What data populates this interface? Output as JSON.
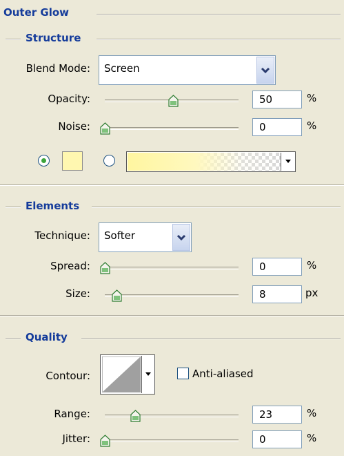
{
  "outer_glow": {
    "title": "Outer Glow",
    "structure": {
      "title": "Structure",
      "blend_mode_label": "Blend Mode:",
      "blend_mode_value": "Screen",
      "opacity_label": "Opacity:",
      "opacity_value": "50",
      "opacity_unit": "%",
      "noise_label": "Noise:",
      "noise_value": "0",
      "noise_unit": "%",
      "color_swatch": "#fff7b0",
      "gradient_colors": [
        "#fff7a6",
        "#fffbe0"
      ]
    },
    "elements": {
      "title": "Elements",
      "technique_label": "Technique:",
      "technique_value": "Softer",
      "spread_label": "Spread:",
      "spread_value": "0",
      "spread_unit": "%",
      "size_label": "Size:",
      "size_value": "8",
      "size_unit": "px"
    },
    "quality": {
      "title": "Quality",
      "contour_label": "Contour:",
      "anti_aliased_label": "Anti-aliased",
      "range_label": "Range:",
      "range_value": "23",
      "range_unit": "%",
      "jitter_label": "Jitter:",
      "jitter_value": "0",
      "jitter_unit": "%"
    }
  },
  "icons": {
    "dropdown_arrow": "chevron-down-icon",
    "slider_thumb": "slider-thumb-icon"
  },
  "accent_color": "#153c9b"
}
